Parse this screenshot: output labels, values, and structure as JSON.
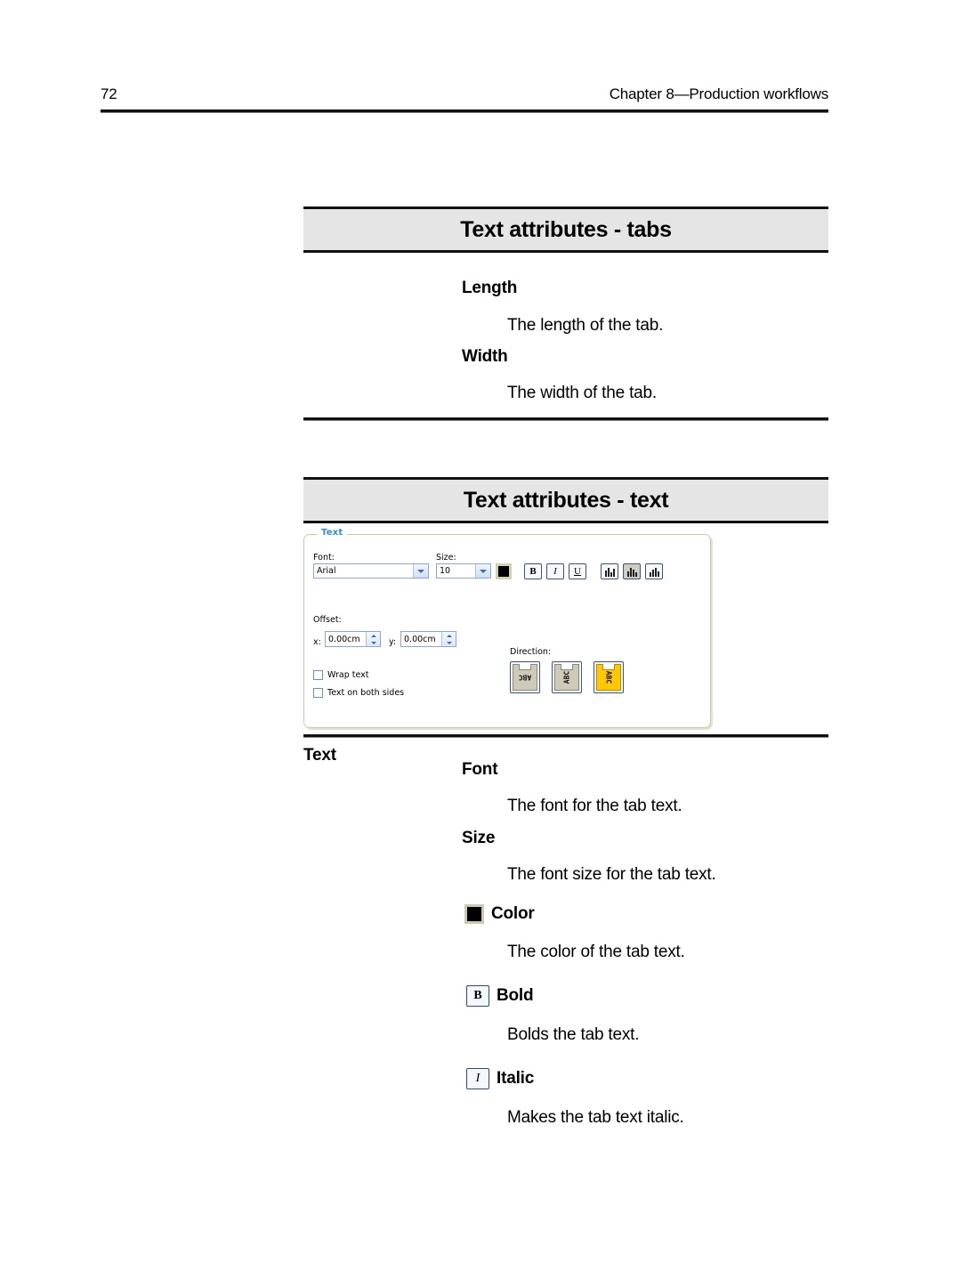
{
  "header": {
    "page_number": "72",
    "chapter": "Chapter 8—Production workflows"
  },
  "sections": [
    {
      "title": "Text attributes - tabs",
      "entries": [
        {
          "term": "Length",
          "definition": "The length of the tab."
        },
        {
          "term": "Width",
          "definition": "The width of the tab."
        }
      ]
    },
    {
      "title": "Text attributes - text",
      "group_label": "Text",
      "entries": [
        {
          "term": "Font",
          "definition": "The font for the tab text."
        },
        {
          "term": "Size",
          "definition": "The font size for the tab text."
        },
        {
          "term": "Color",
          "definition": "The color of the tab text.",
          "icon": "color-swatch-icon"
        },
        {
          "term": "Bold",
          "definition": "Bolds the tab text.",
          "icon": "bold-icon",
          "icon_glyph": "B"
        },
        {
          "term": "Italic",
          "definition": "Makes the tab text italic.",
          "icon": "italic-icon",
          "icon_glyph": "I"
        }
      ]
    }
  ],
  "dialog": {
    "legend": "Text",
    "font_label": "Font:",
    "font_value": "Arial",
    "size_label": "Size:",
    "size_value": "10",
    "color_value": "#000000",
    "style_buttons": [
      {
        "name": "bold-button",
        "glyph": "B",
        "pressed": false
      },
      {
        "name": "italic-button",
        "glyph": "I",
        "pressed": false
      },
      {
        "name": "underline-button",
        "glyph": "U",
        "pressed": false
      }
    ],
    "align_buttons": [
      {
        "name": "align-left-button",
        "pressed": false
      },
      {
        "name": "align-center-button",
        "pressed": true
      },
      {
        "name": "align-right-button",
        "pressed": false
      }
    ],
    "offset_label": "Offset:",
    "offset_x_label": "x:",
    "offset_x_value": "0.00cm",
    "offset_y_label": "y:",
    "offset_y_value": "0.00cm",
    "checkboxes": [
      {
        "label": "Wrap text",
        "checked": false
      },
      {
        "label": "Text on both sides",
        "checked": false
      }
    ],
    "direction_label": "Direction:",
    "direction_buttons": [
      {
        "name": "direction-rotated-180-button",
        "glyph": "ABC",
        "selected": false
      },
      {
        "name": "direction-rotated-ccw-button",
        "glyph": "ABC",
        "selected": false
      },
      {
        "name": "direction-rotated-cw-button",
        "glyph": "ABC",
        "selected": true
      }
    ]
  },
  "colors": {
    "banner_bg": "#e5e5e5",
    "rule": "#111111",
    "legend_blue": "#2e8be0",
    "selected_yellow": "#ffc800"
  }
}
